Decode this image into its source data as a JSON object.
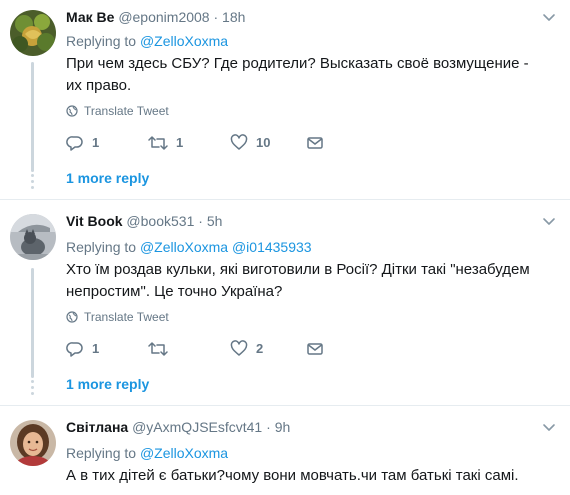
{
  "tweets": [
    {
      "name": "Мак Ве",
      "handle": "@eponim2008",
      "separator": "·",
      "time": "18h",
      "replying_prefix": "Replying to ",
      "mentions": [
        "@ZelloXoxma"
      ],
      "text": "При чем здесь СБУ? Где родители? Высказать своё возмущение - их право.",
      "translate_label": "Translate Tweet",
      "replies_count": "1",
      "retweets_count": "1",
      "likes_count": "10",
      "more_replies": "1 more reply"
    },
    {
      "name": "Vit Book",
      "handle": "@book531",
      "separator": "·",
      "time": "5h",
      "replying_prefix": "Replying to ",
      "mentions": [
        "@ZelloXoxma",
        "@i01435933"
      ],
      "text": "Хто їм роздав кульки, які виготовили в Росії? Дітки такі \"незабудем непростим\". Це точно Україна?",
      "translate_label": "Translate Tweet",
      "replies_count": "1",
      "retweets_count": "",
      "likes_count": "2",
      "more_replies": "1 more reply"
    },
    {
      "name": "Світлана",
      "handle": "@yAxmQJSEsfcvt41",
      "separator": "·",
      "time": "9h",
      "replying_prefix": "Replying to ",
      "mentions": [
        "@ZelloXoxma"
      ],
      "text": "А в тих дітей є батьки?чому вони мовчать.чи там батькі такі самі."
    }
  ],
  "icons": {
    "reply": "reply-icon",
    "retweet": "retweet-icon",
    "like": "heart-icon",
    "dm": "envelope-icon",
    "translate": "globe-icon",
    "more": "chevron-down-icon"
  },
  "colors": {
    "link": "#1b95e0",
    "muted": "#657786",
    "text": "#14171a",
    "thread": "#ccd6dd"
  }
}
